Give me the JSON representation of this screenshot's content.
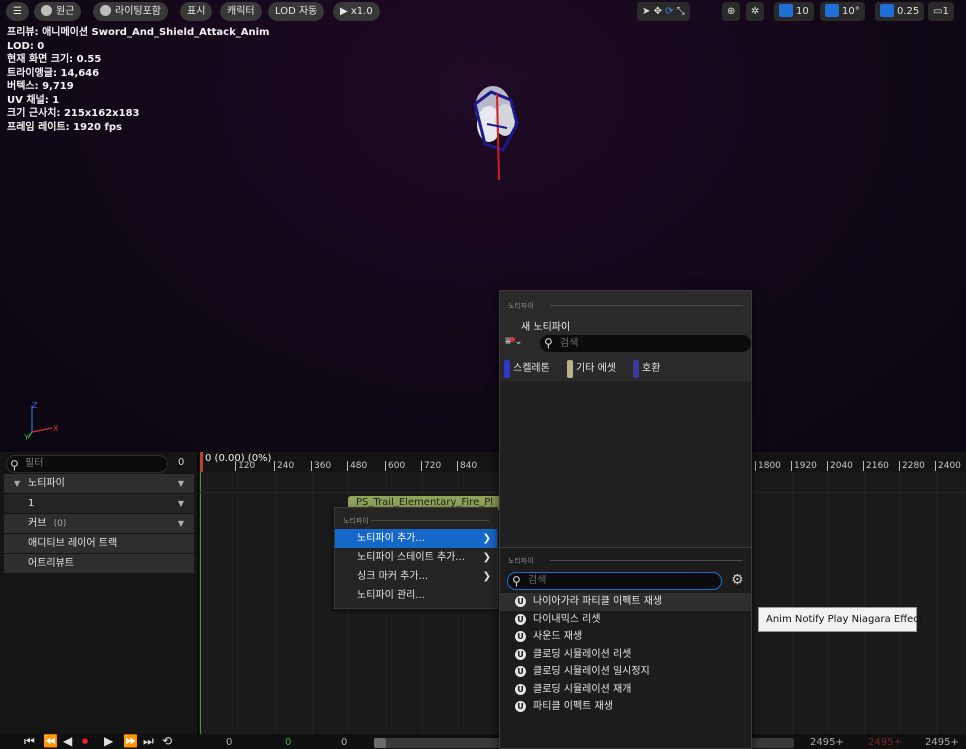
{
  "toolbar": {
    "menu_label": "☰",
    "perspective_label": "원근",
    "lighting_label": "라이팅포함",
    "show_label": "표시",
    "character_label": "캐릭터",
    "lod_label": "LOD 자동",
    "play_rate_label": "x1.0",
    "grid_snap_value": "10",
    "rotation_snap_value": "10°",
    "scale_snap_value": "0.25",
    "camera_speed_value": "1"
  },
  "stats": {
    "preview": "프리뷰: 애니메이션 Sword_And_Shield_Attack_Anim",
    "lod": "LOD: 0",
    "screen_size": "현재 화면 크기: 0.55",
    "triangles": "트라이앵글: 14,646",
    "vertices": "버텍스: 9,719",
    "uv_channels": "UV 채널: 1",
    "approx_size": "크기 근사치: 215x162x183",
    "frame_rate": "프레임 레이트: 1920 fps"
  },
  "axis": {
    "z": "Z",
    "x": "X",
    "y": "Y"
  },
  "tracks": {
    "filter_placeholder": "필터",
    "filter_count": "0",
    "rows": {
      "notifies": "노티파이",
      "track1": "1",
      "curves": "커브",
      "curves_count": "(0)",
      "additive": "애디티브 레이어 트랙",
      "attributes": "어트리뷰트"
    }
  },
  "timeline": {
    "frame_label": "0 (0.00) (0%)",
    "ticks": [
      "120",
      "240",
      "360",
      "480",
      "600",
      "720",
      "840",
      "1800",
      "1920",
      "2040",
      "2160",
      "2280",
      "2400"
    ],
    "notify_bar": "PS_Trail_Elementary_Fire_Pl"
  },
  "transport": {
    "start_value": "0",
    "mid_value": "0",
    "end_value": "0",
    "right_value_1": "2495+",
    "right_value_2": "2495+",
    "right_value_3": "2495+"
  },
  "context_menu": {
    "section": "노티파이",
    "items": {
      "add_notify": "노티파이 추가...",
      "add_state": "노티파이 스테이트 추가...",
      "add_sync": "싱크 마커 추가...",
      "manage": "노티파이 관리..."
    }
  },
  "picker": {
    "section_top": "노티파이",
    "new_notify": "새 노티파이",
    "search_placeholder": "검색",
    "chips": {
      "skeleton": "스켈레톤",
      "other_assets": "기타 에셋",
      "compatible": "호환"
    },
    "section_bottom": "노티파이",
    "search2_placeholder": "검색",
    "options": {
      "niagara": "나이아가라 파티클 이펙트 재생",
      "dynamics": "다이내믹스 리셋",
      "sound": "사운드 재생",
      "cloth_reset": "클로딩 시뮬레이션 리셋",
      "cloth_pause": "클로딩 시뮬레이션 일시정지",
      "cloth_resume": "클로딩 시뮬레이션 재개",
      "particle": "파티클 이펙트 재생"
    }
  },
  "tooltip": {
    "text": "Anim Notify Play Niagara Effect"
  },
  "colors": {
    "accent": "#1567c8",
    "notify_bar": "#8fa35a",
    "record": "#e12525"
  }
}
